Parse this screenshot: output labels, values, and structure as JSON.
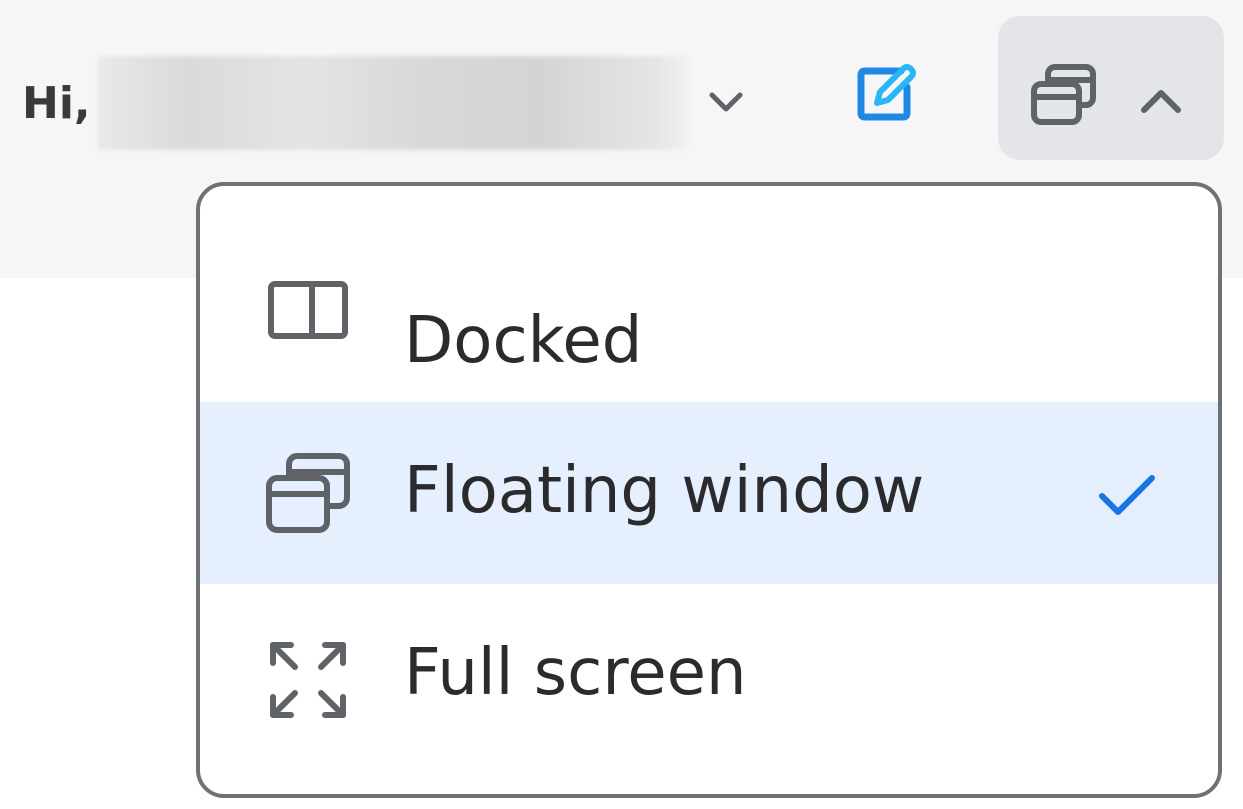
{
  "header": {
    "greeting": "Hi,"
  },
  "view_menu": {
    "items": [
      {
        "label": "Docked",
        "icon": "docked-panel-icon",
        "selected": false
      },
      {
        "label": "Floating window",
        "icon": "floating-window-icon",
        "selected": true
      },
      {
        "label": "Full screen",
        "icon": "full-screen-icon",
        "selected": false
      }
    ]
  },
  "colors": {
    "accent": "#1a73e8",
    "compose_icon": "#1e88e5",
    "selected_row": "#e5effd",
    "header_bg": "#f6f6f7",
    "toggle_bg": "#e4e5e8",
    "menu_border": "#6e7178",
    "icon_gray": "#5f6368",
    "text": "#2b2b2e"
  }
}
